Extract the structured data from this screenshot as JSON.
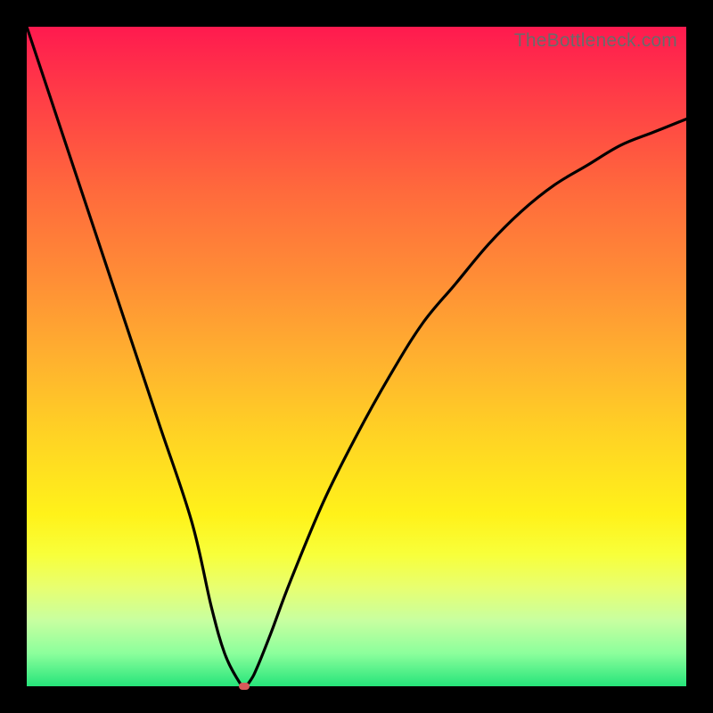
{
  "watermark": "TheBottleneck.com",
  "colors": {
    "frame": "#000000",
    "gradient_top": "#ff1a4f",
    "gradient_mid": "#ffd324",
    "gradient_bottom": "#26e47a",
    "curve": "#000000",
    "marker": "#d65a5a"
  },
  "chart_data": {
    "type": "line",
    "title": "",
    "xlabel": "",
    "ylabel": "",
    "xlim": [
      0,
      100
    ],
    "ylim": [
      0,
      100
    ],
    "grid": false,
    "legend": false,
    "annotations": [],
    "series": [
      {
        "name": "bottleneck-curve",
        "x": [
          0,
          5,
          10,
          15,
          20,
          25,
          28,
          30,
          32,
          33,
          34,
          35,
          37,
          40,
          45,
          50,
          55,
          60,
          65,
          70,
          75,
          80,
          85,
          90,
          95,
          100
        ],
        "y": [
          100,
          85,
          70,
          55,
          40,
          25,
          12,
          5,
          1,
          0,
          1,
          3,
          8,
          16,
          28,
          38,
          47,
          55,
          61,
          67,
          72,
          76,
          79,
          82,
          84,
          86
        ]
      }
    ],
    "marker": {
      "x": 33,
      "y": 0
    }
  }
}
